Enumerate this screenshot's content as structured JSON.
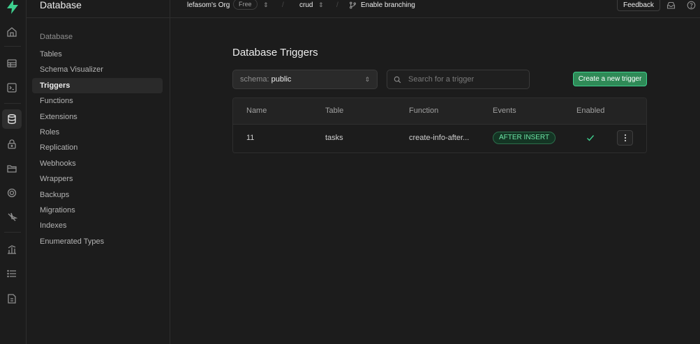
{
  "sidebar": {
    "title": "Database",
    "section_label": "Database",
    "items": [
      {
        "label": "Tables"
      },
      {
        "label": "Schema Visualizer"
      },
      {
        "label": "Triggers",
        "active": true
      },
      {
        "label": "Functions"
      },
      {
        "label": "Extensions"
      },
      {
        "label": "Roles"
      },
      {
        "label": "Replication"
      },
      {
        "label": "Webhooks"
      },
      {
        "label": "Wrappers"
      },
      {
        "label": "Backups"
      },
      {
        "label": "Migrations"
      },
      {
        "label": "Indexes"
      },
      {
        "label": "Enumerated Types"
      }
    ]
  },
  "topbar": {
    "org": "lefasom's Org",
    "plan": "Free",
    "separator": "/",
    "project": "crud",
    "branching": "Enable branching",
    "feedback": "Feedback"
  },
  "main": {
    "title": "Database Triggers",
    "schema_label": "schema:",
    "schema_value": "public",
    "search_placeholder": "Search for a trigger",
    "create_button": "Create a new trigger",
    "columns": [
      "Name",
      "Table",
      "Function",
      "Events",
      "Enabled"
    ],
    "rows": [
      {
        "name": "11",
        "table": "tasks",
        "function": "create-info-after...",
        "event": "AFTER INSERT",
        "enabled": true
      }
    ]
  },
  "colors": {
    "accent": "#3ecf8e",
    "background": "#1c1c1c",
    "border": "#2e2e2e"
  },
  "icons": [
    "supabase-logo-icon",
    "home-icon",
    "table-editor-icon",
    "sql-editor-icon",
    "database-icon",
    "auth-lock-icon",
    "storage-icon",
    "realtime-icon",
    "edge-functions-icon",
    "reports-icon",
    "logs-icon",
    "api-docs-icon",
    "inbox-icon",
    "help-icon",
    "search-icon",
    "check-icon",
    "more-vertical-icon",
    "branch-icon"
  ]
}
